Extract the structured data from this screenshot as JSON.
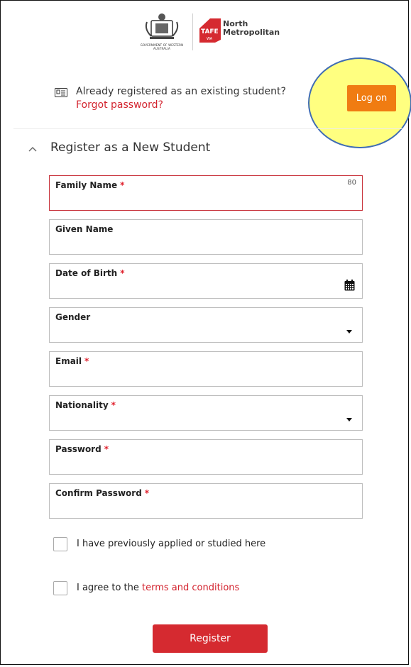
{
  "header": {
    "crest_caption": "GOVERNMENT OF WESTERN AUSTRALIA",
    "tafe_mark": "TAFE",
    "tafe_mark_sub": "WA",
    "tafe_name_line1": "North",
    "tafe_name_line2": "Metropolitan"
  },
  "existing": {
    "prompt": "Already registered as an existing student?",
    "forgot_link": "Forgot password?",
    "logon_label": "Log on"
  },
  "section": {
    "title": "Register as a New Student"
  },
  "fields": {
    "family_name": {
      "label": "Family Name",
      "required": "*",
      "counter": "80"
    },
    "given_name": {
      "label": "Given Name"
    },
    "dob": {
      "label": "Date of Birth",
      "required": "*"
    },
    "gender": {
      "label": "Gender"
    },
    "email": {
      "label": "Email",
      "required": "*"
    },
    "nationality": {
      "label": "Nationality",
      "required": "*"
    },
    "password": {
      "label": "Password",
      "required": "*"
    },
    "confirm_password": {
      "label": "Confirm Password",
      "required": "*"
    }
  },
  "checks": {
    "previous": {
      "label": "I have previously applied or studied here"
    },
    "terms": {
      "prefix": "I agree to the ",
      "link": "terms and conditions"
    }
  },
  "register_label": "Register",
  "colors": {
    "accent_red": "#d52a30",
    "logon_orange": "#f07c12",
    "highlight_yellow": "#ffff80",
    "highlight_border": "#3f6cb4"
  }
}
